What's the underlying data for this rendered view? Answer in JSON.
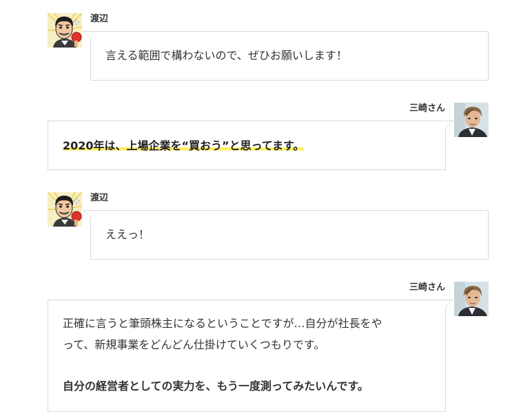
{
  "messages": [
    {
      "speaker": "渡辺",
      "side": "left",
      "avatar": "watanabe-illustration",
      "lines": [
        "言える範囲で構わないので、ぜひお願いします！"
      ]
    },
    {
      "speaker": "三崎さん",
      "side": "right",
      "avatar": "misaki-photo",
      "highlight": "2020年は、上場企業を“買おう”と思ってます。"
    },
    {
      "speaker": "渡辺",
      "side": "left",
      "avatar": "watanabe-illustration",
      "lines": [
        "ええっ！"
      ]
    },
    {
      "speaker": "三崎さん",
      "side": "right",
      "avatar": "misaki-photo",
      "lines": [
        "正確に言うと筆頭株主になるということですが…自分が社長をや",
        "って、新規事業をどんどん仕掛けていくつもりです。"
      ],
      "bold": "自分の経営者としての実力を、もう一度測ってみたいんです。"
    }
  ],
  "colors": {
    "border": "#d8d8d8",
    "text": "#333333",
    "highlight": "#ffef5e"
  }
}
